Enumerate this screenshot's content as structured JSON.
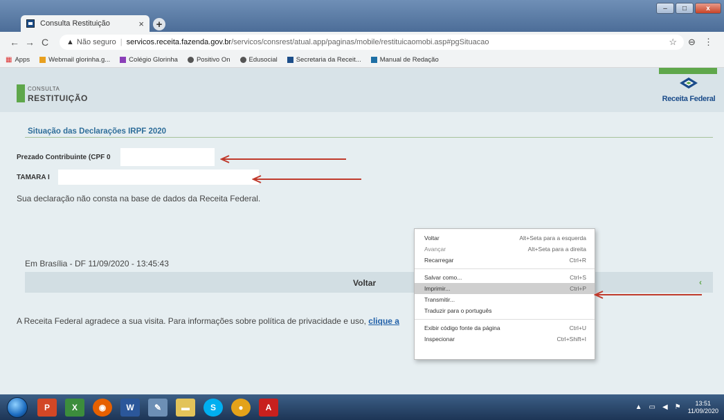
{
  "browser": {
    "tab_title": "Consulta Restituição",
    "tab_close": "×",
    "new_tab": "+",
    "nav": {
      "back": "←",
      "forward": "→",
      "reload": "C"
    },
    "address": {
      "insecure_label": "Não seguro",
      "host": "servicos.receita.fazenda.gov.br",
      "path": "/servicos/consrest/atual.app/paginas/mobile/restituicaomobi.asp#pgSituacao"
    },
    "window_controls": {
      "minimize": "–",
      "maximize": "□",
      "close": "x"
    },
    "bookmarks": [
      {
        "label": "Apps",
        "icon": "apps-grid-icon",
        "color": "#d33"
      },
      {
        "label": "Webmail glorinha.g...",
        "icon": "webmail-icon",
        "color": "#e8a020"
      },
      {
        "label": "Colégio Glorinha",
        "icon": "colegio-icon",
        "color": "#8a3fb8"
      },
      {
        "label": "Positivo On",
        "icon": "globe-icon",
        "color": "#555"
      },
      {
        "label": "Edusocial",
        "icon": "globe-icon",
        "color": "#555"
      },
      {
        "label": "Secretaria da Receit...",
        "icon": "receita-icon",
        "color": "#1d4e89"
      },
      {
        "label": "Manual de Redação",
        "icon": "manual-icon",
        "color": "#1d6fa5"
      }
    ]
  },
  "page": {
    "brand_small": "CONSULTA",
    "brand_big": "RESTITUIÇÃO",
    "logo_text": "Receita Federal",
    "section_title": "Situação das Declarações IRPF 2020",
    "cpf_label": "Prezado Contribuinte (CPF 0",
    "name_label": "TAMARA I",
    "message": "Sua declaração não consta na base de dados da Receita Federal.",
    "dateline": "Em Brasília - DF   11/09/2020 - 13:45:43",
    "voltar": "Voltar",
    "voltar_chevron": "‹",
    "thanks_text": "A Receita Federal agradece a sua visita. Para informações sobre política de privacidade e uso, ",
    "thanks_link": "clique a"
  },
  "context_menu": {
    "items": [
      {
        "label": "Voltar",
        "shortcut": "Alt+Seta para a esquerda",
        "disabled": false
      },
      {
        "label": "Avançar",
        "shortcut": "Alt+Seta para a direita",
        "disabled": true
      },
      {
        "label": "Recarregar",
        "shortcut": "Ctrl+R",
        "disabled": false
      },
      {
        "label": "Salvar como...",
        "shortcut": "Ctrl+S",
        "disabled": false
      },
      {
        "label": "Imprimir...",
        "shortcut": "Ctrl+P",
        "disabled": false,
        "highlighted": true
      },
      {
        "label": "Transmitir...",
        "shortcut": "",
        "disabled": false
      },
      {
        "label": "Traduzir para o português",
        "shortcut": "",
        "disabled": false
      },
      {
        "label": "Exibir código fonte da página",
        "shortcut": "Ctrl+U",
        "disabled": false
      },
      {
        "label": "Inspecionar",
        "shortcut": "Ctrl+Shift+I",
        "disabled": false
      }
    ]
  },
  "taskbar": {
    "clock_time": "13:51",
    "clock_date": "11/09/2020"
  },
  "colors": {
    "accent_green": "#5fa74b",
    "title_blue": "#2f6e9a",
    "arrow_red": "#c0392b"
  }
}
